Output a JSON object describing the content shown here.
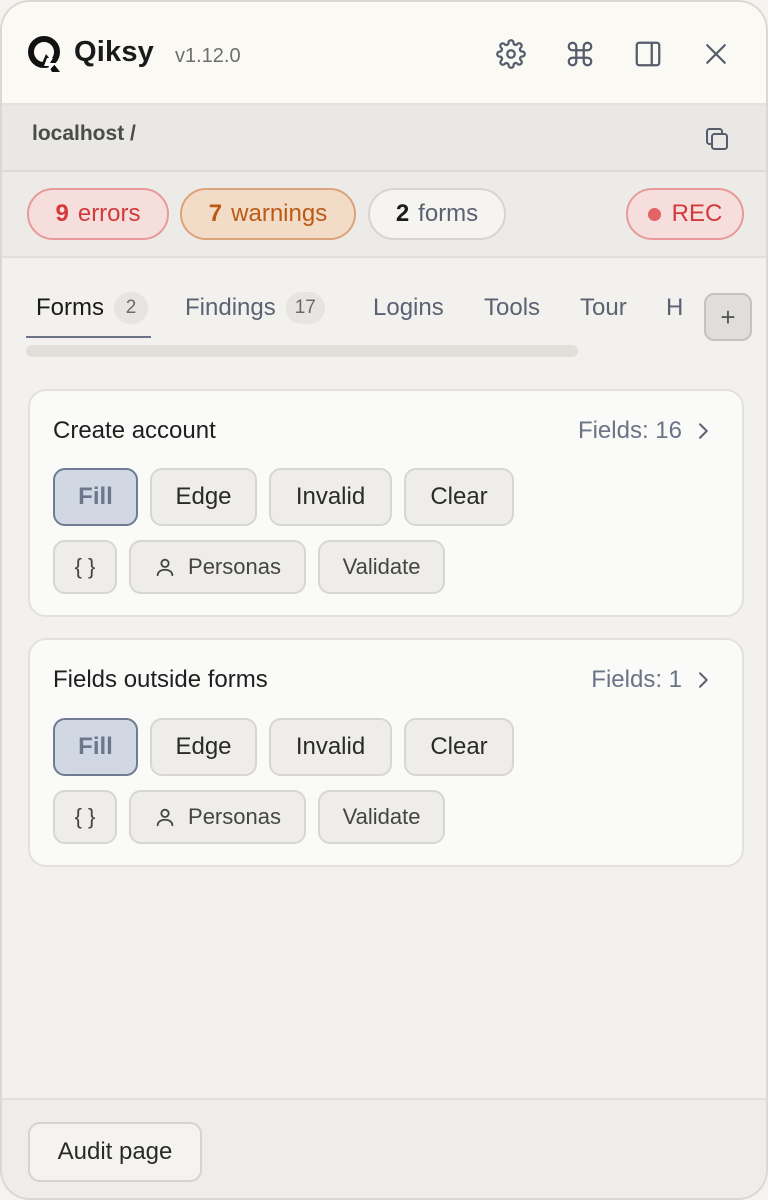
{
  "header": {
    "brand": "Qiksy",
    "version": "v1.12.0",
    "icons": [
      "gear-icon",
      "command-icon",
      "sidebar-toggle-icon",
      "close-icon"
    ]
  },
  "url": {
    "text": "localhost /",
    "copy_icon": "copy-icon"
  },
  "status": {
    "errors": {
      "count": "9",
      "label": "errors"
    },
    "warnings": {
      "count": "7",
      "label": "warnings"
    },
    "forms": {
      "count": "2",
      "label": "forms"
    },
    "rec": {
      "label": "REC"
    }
  },
  "tabs": [
    {
      "label": "Forms",
      "count": "2"
    },
    {
      "label": "Findings",
      "count": "17"
    },
    {
      "label": "Logins"
    },
    {
      "label": "Tools"
    },
    {
      "label": "Tour"
    },
    {
      "label": "H"
    }
  ],
  "tab_add": "+",
  "cards": [
    {
      "title": "Create account",
      "fields": "Fields: 16",
      "buttons": [
        "Fill",
        "Edge",
        "Invalid",
        "Clear"
      ],
      "json_btn": "{ }",
      "personas": "Personas",
      "validate": "Validate"
    },
    {
      "title": "Fields outside forms",
      "fields": "Fields: 1",
      "buttons": [
        "Fill",
        "Edge",
        "Invalid",
        "Clear"
      ],
      "json_btn": "{ }",
      "personas": "Personas",
      "validate": "Validate"
    }
  ],
  "footer": {
    "audit": "Audit page"
  },
  "colors": {
    "error": "#d23a3a",
    "warning": "#bb5a14",
    "primary_button": "#d1d8e3",
    "background": "#f2f1ed"
  }
}
